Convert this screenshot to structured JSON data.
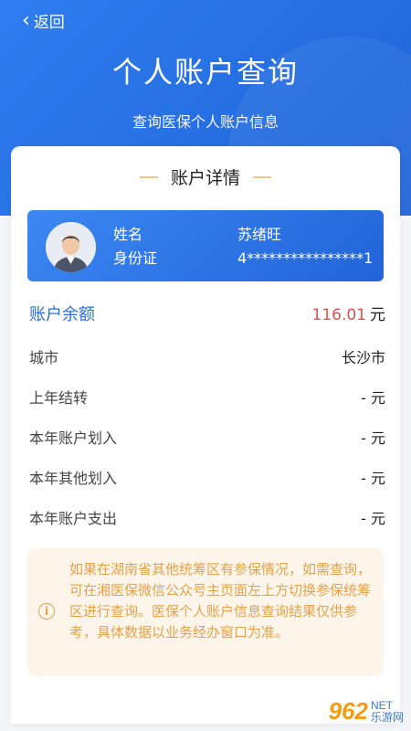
{
  "nav": {
    "back_label": "返回"
  },
  "header": {
    "title": "个人账户查询",
    "subtitle": "查询医保个人账户信息"
  },
  "card": {
    "title": "账户详情"
  },
  "identity": {
    "name_label": "姓名",
    "id_label": "身份证",
    "name_value": "苏绪旺",
    "id_value": "4****************1"
  },
  "balance": {
    "label": "账户余额",
    "amount": "116.01",
    "unit": "元"
  },
  "rows": [
    {
      "label": "城市",
      "value": "长沙市"
    },
    {
      "label": "上年结转",
      "value": "- 元"
    },
    {
      "label": "本年账户划入",
      "value": "- 元"
    },
    {
      "label": "本年其他划入",
      "value": "- 元"
    },
    {
      "label": "本年账户支出",
      "value": "- 元"
    }
  ],
  "notice": {
    "text": "如果在湖南省其他统筹区有参保情况，如需查询，可在湘医保微信公众号主页面左上方切换参保统筹区进行查询。医保个人账户信息查询结果仅供参考，具体数据以业务经办窗口为准。"
  },
  "watermark": {
    "main": "962",
    "sub_top": "NET",
    "sub_bottom": "乐游网"
  },
  "colors": {
    "primary": "#2a6ed6",
    "amount": "#d9534f",
    "notice": "#e3a24b"
  }
}
